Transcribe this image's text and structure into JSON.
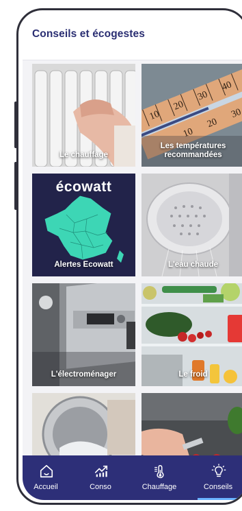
{
  "header": {
    "title": "Conseils et écogestes"
  },
  "tiles": [
    {
      "label": "Le chauffage",
      "icon": "radiator-hands-image"
    },
    {
      "label": "Les températures recommandées",
      "icon": "thermometer-image"
    },
    {
      "label": "Alertes Ecowatt",
      "icon": "ecowatt-france-map-image",
      "brand": "écowatt",
      "brand_bg": "#22234a",
      "brand_accent": "#3dd6b5"
    },
    {
      "label": "L'eau chaude",
      "icon": "shower-head-image"
    },
    {
      "label": "L'électroménager",
      "icon": "washing-machine-image"
    },
    {
      "label": "Le froid",
      "icon": "fridge-image"
    },
    {
      "label": "",
      "icon": "laundry-image"
    },
    {
      "label": "",
      "icon": "cooking-image"
    }
  ],
  "thermo_ticks": [
    "40",
    "30",
    "20",
    "10",
    "30",
    "20",
    "10"
  ],
  "nav": {
    "items": [
      {
        "label": "Accueil",
        "icon": "home-icon"
      },
      {
        "label": "Conso",
        "icon": "chart-icon"
      },
      {
        "label": "Chauffage",
        "icon": "thermometer-icon"
      },
      {
        "label": "Conseils",
        "icon": "lightbulb-icon",
        "active": true
      }
    ],
    "bg": "#2d2f78",
    "active_color": "#69b3ff"
  }
}
